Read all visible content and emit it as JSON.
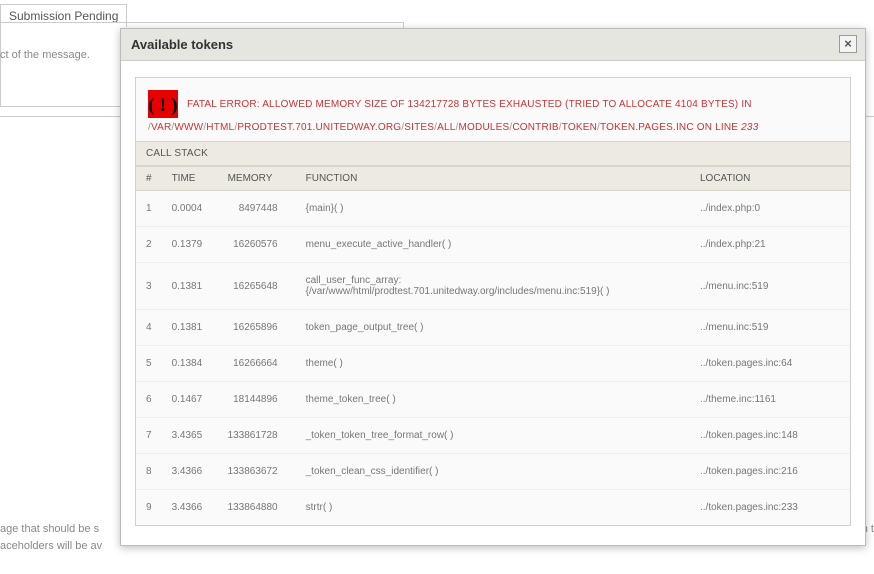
{
  "behind": {
    "tab_label": "Submission Pending",
    "subject_hint": "ct of the message.",
    "bottom_line1": "age that should be s",
    "bottom_line2": "aceholders will be av",
    "bottom_right": "ent each t"
  },
  "modal": {
    "title": "Available tokens",
    "close_glyph": "×"
  },
  "error": {
    "line1": "FATAL ERROR: ALLOWED MEMORY SIZE OF 134217728 BYTES EXHAUSTED (TRIED TO ALLOCATE 4104 BYTES) IN",
    "path_segments": [
      "VAR",
      "WWW",
      "HTML",
      "PRODTEST.701.UNITEDWAY.ORG",
      "SITES",
      "ALL",
      "MODULES",
      "CONTRIB",
      "TOKEN",
      "TOKEN.PAGES.INC"
    ],
    "on_line": "ON LINE",
    "line_number": "233"
  },
  "stack": {
    "heading": "CALL STACK",
    "columns": {
      "n": "#",
      "time": "TIME",
      "memory": "MEMORY",
      "function": "FUNCTION",
      "location": "LOCATION"
    },
    "rows": [
      {
        "n": "1",
        "time": "0.0004",
        "memory": "8497448",
        "func": "{main}( )",
        "loc": "../index.php:0"
      },
      {
        "n": "2",
        "time": "0.1379",
        "memory": "16260576",
        "func": "menu_execute_active_handler( )",
        "loc": "../index.php:21"
      },
      {
        "n": "3",
        "time": "0.1381",
        "memory": "16265648",
        "func": "call_user_func_array:\n{/var/www/html/prodtest.701.unitedway.org/includes/menu.inc:519}( )",
        "loc": "../menu.inc:519"
      },
      {
        "n": "4",
        "time": "0.1381",
        "memory": "16265896",
        "func": "token_page_output_tree( )",
        "loc": "../menu.inc:519"
      },
      {
        "n": "5",
        "time": "0.1384",
        "memory": "16266664",
        "func": "theme( )",
        "loc": "../token.pages.inc:64"
      },
      {
        "n": "6",
        "time": "0.1467",
        "memory": "18144896",
        "func": "theme_token_tree( )",
        "loc": "../theme.inc:1161"
      },
      {
        "n": "7",
        "time": "3.4365",
        "memory": "133861728",
        "func": "_token_token_tree_format_row( )",
        "loc": "../token.pages.inc:148"
      },
      {
        "n": "8",
        "time": "3.4366",
        "memory": "133863672",
        "func": "_token_clean_css_identifier( )",
        "loc": "../token.pages.inc:216"
      },
      {
        "n": "9",
        "time": "3.4366",
        "memory": "133864880",
        "func": "strtr( )",
        "loc": "../token.pages.inc:233"
      }
    ]
  }
}
